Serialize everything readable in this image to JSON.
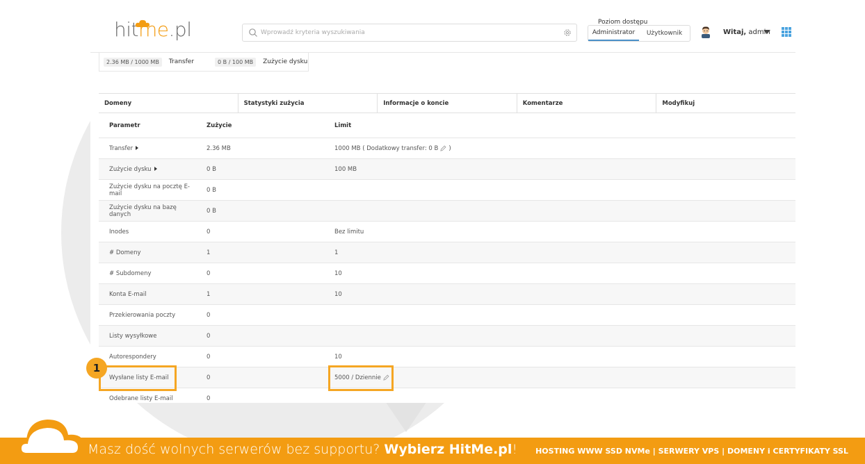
{
  "header": {
    "logo_left": "hit",
    "logo_me": "me",
    "logo_right": ".pl",
    "search_placeholder": "Wprowadź kryteria wyszukiwania",
    "access_title": "Poziom dostępu",
    "access_tabs": [
      "Administrator",
      "Użytkownik"
    ],
    "access_active": "Administrator",
    "welcome_prefix": "Witaj,",
    "welcome_user": "admin"
  },
  "summary": {
    "transfer_value": "2.36 MB / 1000 MB",
    "transfer_label": "Transfer",
    "disk_value": "0 B / 100 MB",
    "disk_label": "Zużycie dysku"
  },
  "tabs": [
    "Domeny",
    "Statystyki zużycia",
    "Informacje o koncie",
    "Komentarze",
    "Modyfikuj"
  ],
  "active_tab": "Statystyki zużycia",
  "table": {
    "headers": [
      "Parametr",
      "Zużycie",
      "Limit"
    ],
    "rows": [
      {
        "param": "Transfer",
        "usage": "2.36 MB",
        "limit": "1000 MB ( Dodatkowy transfer: 0 B",
        "limit_suffix": ")",
        "arrow": true,
        "pencil": true
      },
      {
        "param": "Zużycie dysku",
        "usage": "0 B",
        "limit": "100 MB",
        "arrow": true
      },
      {
        "param": "Zużycie dysku na pocztę E-mail",
        "usage": "0 B",
        "limit": ""
      },
      {
        "param": "Zużycie dysku na bazę danych",
        "usage": "0 B",
        "limit": ""
      },
      {
        "param": "Inodes",
        "usage": "0",
        "limit": "Bez limitu"
      },
      {
        "param": "# Domeny",
        "usage": "1",
        "limit": "1"
      },
      {
        "param": "# Subdomeny",
        "usage": "0",
        "limit": "10"
      },
      {
        "param": "Konta E-mail",
        "usage": "1",
        "limit": "10"
      },
      {
        "param": "Przekierowania poczty",
        "usage": "0",
        "limit": ""
      },
      {
        "param": "Listy wysyłkowe",
        "usage": "0",
        "limit": ""
      },
      {
        "param": "Autorespondery",
        "usage": "0",
        "limit": "10"
      },
      {
        "param": "Wysłane listy E-mail",
        "usage": "0",
        "limit": "5000 / Dziennie",
        "pencil": true
      },
      {
        "param": "Odebrane listy E-mail",
        "usage": "0",
        "limit": ""
      }
    ]
  },
  "annotation": {
    "badge": "1"
  },
  "banner": {
    "text_prefix": "Masz dość wolnych serwerów bez supportu?",
    "text_bold": "Wybierz HitMe.pl",
    "text_suffix": "!",
    "right_text": "HOSTING WWW SSD NVMe | SERWERY VPS | DOMENY i CERTYFIKATY SSL"
  },
  "colors": {
    "accent": "#f39c12",
    "highlight": "#f5a623",
    "link": "#4a90c8"
  }
}
